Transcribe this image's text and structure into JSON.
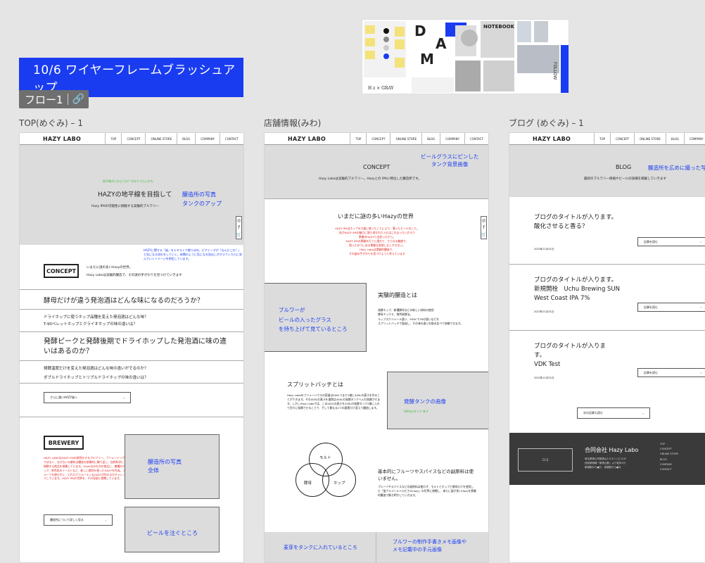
{
  "canvas": {
    "section_title": "10/6 ワイヤーフレームブラッシュアップ",
    "flow_badge": "フロー1",
    "moodboard_caption": "H z × GRAY",
    "moodboard_notebook": "NOTEBOOK",
    "moodboard_follow": "FOLLOW",
    "moodboard_letters": [
      "D",
      "A",
      "M"
    ]
  },
  "frames": {
    "top_title": "TOP(めぐみ) – 1",
    "shop_title": "店舗情報(みわ)",
    "blog_title": "ブログ (めぐみ) – 1"
  },
  "nav": {
    "logo": "HAZY LABO",
    "items": [
      "TOP",
      "CONCEPT",
      "ONLINE STORE",
      "BLOG",
      "COMPANY",
      "CONTACT"
    ]
  },
  "top": {
    "hero_small": "地平線がいかどうか？わかりづらいかも",
    "hero_heading": "HAZYの地平線を目指して",
    "hero_sub": "Hazy IPAの可能性に挑戦する実験的ブルワリー",
    "hero_note": "醸造所の写真\nタンクのアップ",
    "concept_note": "HAZYに関する「謎」をテキストで散りばめ、ピアイーグが「なんだこれ？」と気になる流れをしていく。新聞のように気になる見出しがグラフィカルに並んでいくイメージを想定しています。",
    "concept_label": "CONCEPT",
    "concept_line1": "いまだに謎の多いHazyの世界。",
    "concept_line2": "Hazy Laboは実験的醸造で、その謎の手がかりを見つけていきます",
    "q1": "酵母だけが違う発泡酒はどんな味になるのだろうか？",
    "q2a": "ドライホップに使うホップ品種を変えた発泡酒はどんな味？",
    "q2b": "T-90ペレットホップとクライオホップの味の違いは？",
    "q3": "発酵ピークと発酵後期でドライホップした発泡酒に味の違いはあるのか？",
    "q4a": "発酵温度だけを変えた発泡酒はどんな味の違いがでるのか？",
    "q4b": "ダブルドライホップとトリプルドライホップの味の違いは？",
    "more_btn": "さらに違いHAZY謎へ",
    "brewery_label": "BREWERY",
    "brewery_text": "HAZY LABOはHAZY IPAの研究をするブルワリー。ブリューイングではなく、なぜないる解析は醸造を掛算的に繰り返し、加的科学にも挑戦する商品を規模しています。Glemのみを次の商品に、樽種のかック、射色気のイーストなど、新しい素材を使ったHAZYを作成。フルーツを使わずに、どれだけフルーティなHAZYが作れるかチャレンジしています。HAZY IPAの世界を、その深部に挑戦しています。",
    "brewery_btn": "醸造所について詳しく見る",
    "brewery_photo": "醸造所の写真\n全体",
    "beer_pour": "ビールを注ぐところ"
  },
  "shop": {
    "concept_heading": "CONCEPT",
    "concept_sub": "Hazy Laboは実験的ブルワリー。Hazyとの IPAに特化した醸造所です。",
    "concept_note": "ビールグラスにピンした\nタンク背景画像",
    "mystery_heading": "いまだに謎の多いHazyの世界",
    "mystery_red": "HAZY IPAはホップを大量に使ったことにより、濁ったビールのこと。\n私がHAZY IPAの魅力に取り憑かれた入れはこれまったいだろう\n素敵のHAZYと出会ったから。\nHAZY IPAの実験を行うに連れて、さらなる魅惑で、\n困ったのうにある素敵な思想しなしやきない。\nHazy Laboは実験的醸造で、\nその謎の手がかりを見つけようと考えています",
    "pour_box": "ブルワーが\nビールの入ったグラス\nを持ち上げて見ているところ",
    "experimental_heading": "実験的醸造とは",
    "experimental_text": "発酵ホップ、新種酵母などの新しい材料の使用\n酵母ミックス、独特発酵法。\nラップスケジュール違い、50HCで30の違いなどを\nスプリットバッチで製造し、その味の違いを飲み比べて体験できます。",
    "split_heading": "スプリットバッチとは",
    "split_text": "Hazy Laboのブリューハウスの容量は400Lつまり1基に400Lの麦汁を作ることができます。その400Lの麦汁を通常は400Lの発酵タンクへ入れ発酵させます。しかしHazy Laboでは、この400Lの麦汁を200Lの発酵タンク2基に入れて別々に発酵させることで、そして異なる2つの要素だけ変えて醸造します。",
    "tank_box": "発酵タンクの画像",
    "tank_note": "200Lのタンク ✖ 2",
    "venn": [
      "モルト",
      "酵母",
      "ホップ"
    ],
    "fruit_heading": "基本的にフルーツやスパイスなどの副原料は使いません。",
    "fruit_text": "ブルーツやスパイスなどの副原料は使わず、モルトとホップと酵母だけを使用した「蛍アルコールトロピカルhazy」の世界に挑戦し、来たに謎が多いHazyを実験的醸造で解き明かしていきます。",
    "bottom_left": "麦芽をタンクに入れているところ",
    "bottom_right": "ブルワーの制作手書きメモ画像や\nメモ記載中の手元画像"
  },
  "blog": {
    "heading": "BLOG",
    "sub": "最新のブルワリー情報やビールの詳細を掲載していきます",
    "hero_note": "醸造所を広めに撮った写",
    "posts": [
      {
        "title": "ブログのタイトルが入ります。\n酸化させると香る？",
        "date": "2023年11月31日",
        "btn": "記事を読む"
      },
      {
        "title": "ブログのタイトルが入ります。\n新規開栓　Uchu Brewing SUN\nWest Coast IPA 7%",
        "date": "2023年11月31日",
        "btn": "記事を読む"
      },
      {
        "title": "ブログのタイトルが入りま\nす。\nVDK Test",
        "date": "2023年11月31日",
        "btn": "記事を読む"
      }
    ],
    "next_btn": "次の記事も読む",
    "footer_logo": "ロゴ",
    "footer_company": "合同会社 Hazy Labo",
    "footer_address": "埼玉県狭山市新狭山2-5-8 ○○ビル1F\n西武新宿線「新狭山駅」より徒歩1分\n新宿駅から●分　池袋駅から●分",
    "footer_links": [
      "TOP",
      "CONCEPT",
      "ONLINE STORE",
      "BLOG",
      "COMPANY",
      "CONTACT"
    ]
  },
  "colors": {
    "accent": "#1a3cf0",
    "red": "#e02020",
    "green": "#3cb83c",
    "footer": "#3a3a3a"
  }
}
